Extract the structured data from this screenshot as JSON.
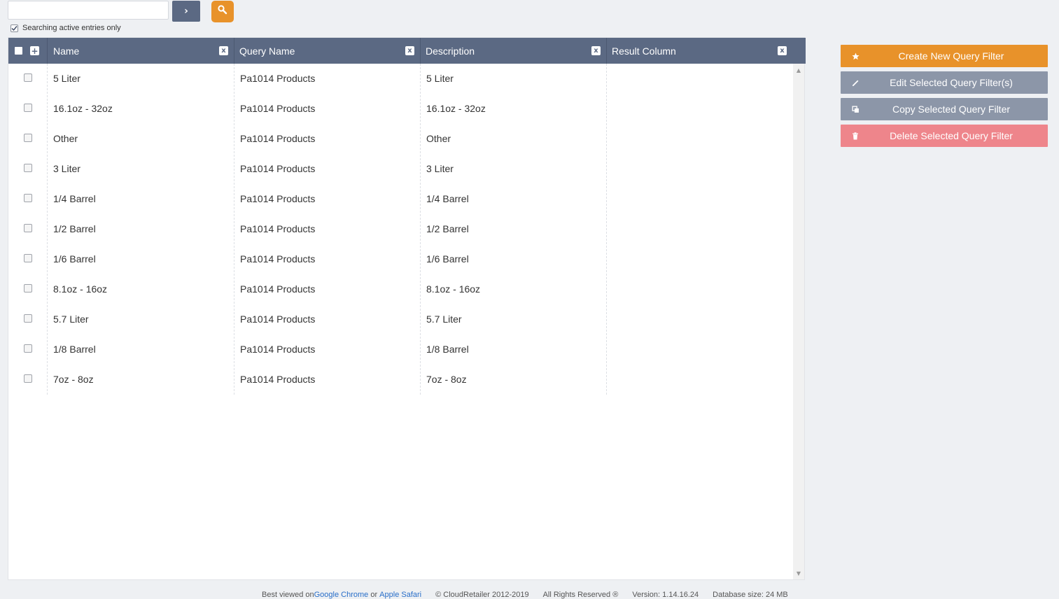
{
  "search": {
    "value": "",
    "placeholder": "",
    "go_label": "›"
  },
  "active_filter": {
    "label": "Searching active entries only",
    "checked": true
  },
  "grid": {
    "columns": [
      {
        "title": "Name",
        "close": "x"
      },
      {
        "title": "Query Name",
        "close": "x"
      },
      {
        "title": "Description",
        "close": "x"
      },
      {
        "title": "Result Column",
        "close": "x"
      }
    ],
    "add_label": "+",
    "rows": [
      {
        "name": "5 Liter",
        "query_name": "Pa1014 Products",
        "description": "5 Liter",
        "result_column": ""
      },
      {
        "name": "16.1oz - 32oz",
        "query_name": "Pa1014 Products",
        "description": "16.1oz - 32oz",
        "result_column": ""
      },
      {
        "name": "Other",
        "query_name": "Pa1014 Products",
        "description": "Other",
        "result_column": ""
      },
      {
        "name": "3 Liter",
        "query_name": "Pa1014 Products",
        "description": "3 Liter",
        "result_column": ""
      },
      {
        "name": "1/4 Barrel",
        "query_name": "Pa1014 Products",
        "description": "1/4 Barrel",
        "result_column": ""
      },
      {
        "name": "1/2 Barrel",
        "query_name": "Pa1014 Products",
        "description": "1/2 Barrel",
        "result_column": ""
      },
      {
        "name": "1/6 Barrel",
        "query_name": "Pa1014 Products",
        "description": "1/6 Barrel",
        "result_column": ""
      },
      {
        "name": "8.1oz - 16oz",
        "query_name": "Pa1014 Products",
        "description": "8.1oz - 16oz",
        "result_column": ""
      },
      {
        "name": "5.7 Liter",
        "query_name": "Pa1014 Products",
        "description": "5.7 Liter",
        "result_column": ""
      },
      {
        "name": "1/8 Barrel",
        "query_name": "Pa1014 Products",
        "description": "1/8 Barrel",
        "result_column": ""
      },
      {
        "name": "7oz - 8oz",
        "query_name": "Pa1014 Products",
        "description": "7oz - 8oz",
        "result_column": ""
      }
    ]
  },
  "actions": {
    "create": {
      "label": "Create New Query Filter",
      "icon": "star-icon",
      "color": "#e8922a"
    },
    "edit": {
      "label": "Edit Selected Query Filter(s)",
      "icon": "pencil-icon",
      "color": "#8c96a8"
    },
    "copy": {
      "label": "Copy Selected Query Filter",
      "icon": "copy-icon",
      "color": "#8c96a8"
    },
    "delete": {
      "label": "Delete Selected Query Filter",
      "icon": "trash-icon",
      "color": "#ee858b"
    }
  },
  "footer": {
    "best_viewed": "Best viewed on ",
    "chrome": "Google Chrome",
    "or": " or ",
    "safari": "Apple Safari",
    "copyright": "© CloudRetailer 2012-2019",
    "rights": "All Rights Reserved ®",
    "version": "Version: 1.14.16.24",
    "db_size": "Database size: 24 MB"
  },
  "colors": {
    "header": "#5b6983",
    "accent": "#e8922a",
    "danger": "#ee858b",
    "neutral": "#8c96a8"
  }
}
